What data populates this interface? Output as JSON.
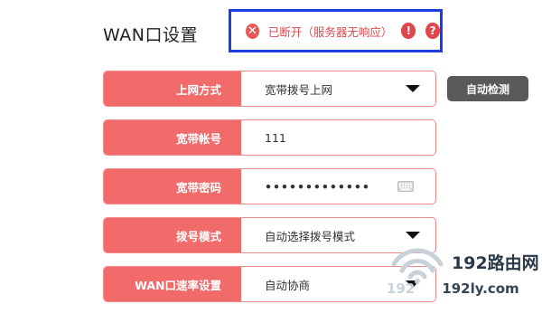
{
  "page": {
    "title": "WAN口设置"
  },
  "status": {
    "text": "已断开（服务器无响应）",
    "color": "#e0474c",
    "box_border_color": "#1a3fdc",
    "icons": [
      "close-circle-icon",
      "exclamation-circle-icon",
      "help-circle-icon"
    ]
  },
  "form": {
    "rows": [
      {
        "label": "上网方式",
        "value": "宽带拨号上网",
        "kind": "dropdown"
      },
      {
        "label": "宽带帐号",
        "value": "111",
        "kind": "text"
      },
      {
        "label": "宽带密码",
        "value": "•••••••••••••",
        "kind": "password"
      },
      {
        "label": "拨号模式",
        "value": "自动选择拨号模式",
        "kind": "dropdown"
      },
      {
        "label": "WAN口速率设置",
        "value": "自动协商",
        "kind": "dropdown"
      }
    ],
    "label_bg_color": "#f26b6b"
  },
  "actions": {
    "detect_label": "自动检测"
  },
  "watermark": {
    "brand": "192路由网",
    "domain_num": "192",
    "domain_rest": "192ly.com"
  }
}
